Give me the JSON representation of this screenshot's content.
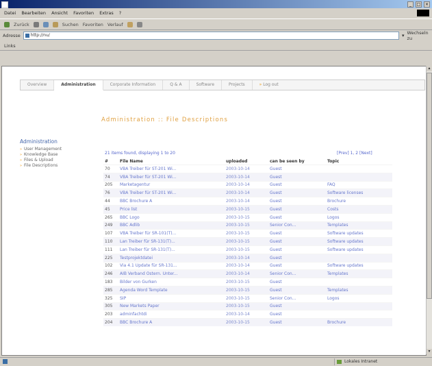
{
  "browser": {
    "menu": [
      "Datei",
      "Bearbeiten",
      "Ansicht",
      "Favoriten",
      "Extras",
      "?"
    ],
    "toolbar": [
      "Zurück",
      "Suchen",
      "Favoriten",
      "Verlauf"
    ],
    "address_label": "Adresse",
    "address_value": "http://nu/",
    "go_label": "Wechseln zu",
    "links_label": "Links",
    "status_zone": "Lokales Intranet",
    "accent": "#0a246a"
  },
  "nav": {
    "tabs": [
      "Overview",
      "Administration",
      "Corporate Information",
      "Q & A",
      "Software",
      "Projects",
      "Log out"
    ],
    "active": "Administration"
  },
  "page": {
    "title": "Administration :: File Descriptions",
    "accent": "#e0a040"
  },
  "sidebar": {
    "heading": "Administration",
    "items": [
      "User Management",
      "Knowledge Base",
      "Files & Upload",
      "File Descriptions"
    ]
  },
  "list": {
    "summary": "21 items found, displaying 1 to 20",
    "pager": "[Prev] 1, 2 [Next]",
    "columns": [
      "#",
      "File Name",
      "uploaded",
      "can be seen by",
      "Topic"
    ],
    "rows": [
      [
        "70",
        "VBA Treiber für ST-201 Wi...",
        "2003-10-14",
        "Guest",
        ""
      ],
      [
        "74",
        "VBA Treiber für ST-201 Wi...",
        "2003-10-14",
        "Guest",
        ""
      ],
      [
        "205",
        "Marketagentur",
        "2003-10-14",
        "Guest",
        "FAQ"
      ],
      [
        "76",
        "VBA Treiber für ST-201 Wi...",
        "2003-10-14",
        "Guest",
        "Software licenses"
      ],
      [
        "44",
        "BBC Brochure A",
        "2003-10-14",
        "Guest",
        "Brochure"
      ],
      [
        "45",
        "Price list",
        "2003-10-15",
        "Guest",
        "Costs"
      ],
      [
        "265",
        "BBC Logo",
        "2003-10-15",
        "Guest",
        "Logos"
      ],
      [
        "249",
        "BBC Adlib",
        "2003-10-15",
        "Senior Con...",
        "Templates"
      ],
      [
        "107",
        "VBA Treiber für SR-101(T)...",
        "2003-10-15",
        "Guest",
        "Software updates"
      ],
      [
        "110",
        "Lan Treiber für SR-131(T)...",
        "2003-10-15",
        "Guest",
        "Software updates"
      ],
      [
        "111",
        "Lan Treiber für SR-131(T)...",
        "2003-10-15",
        "Guest",
        "Software updates"
      ],
      [
        "225",
        "Testprojektdatei",
        "2003-10-14",
        "Guest",
        ""
      ],
      [
        "102",
        "Via 4.1 Update für SR-131...",
        "2003-10-14",
        "Guest",
        "Software updates"
      ],
      [
        "246",
        "AIB Verband Ostern. Unter...",
        "2003-10-14",
        "Senior Con...",
        "Templates"
      ],
      [
        "183",
        "Bilder von Gurken",
        "2003-10-15",
        "Guest",
        ""
      ],
      [
        "285",
        "Agenda Word Template",
        "2003-10-15",
        "Guest",
        "Templates"
      ],
      [
        "325",
        "SIP",
        "2003-10-15",
        "Senior Con...",
        "Logos"
      ],
      [
        "305",
        "New Markets Paper",
        "2003-10-15",
        "Guest",
        ""
      ],
      [
        "203",
        "adminfachtdi",
        "2003-10-14",
        "Guest",
        ""
      ],
      [
        "204",
        "BBC Brochure A",
        "2003-10-15",
        "Guest",
        "Brochure"
      ]
    ]
  }
}
